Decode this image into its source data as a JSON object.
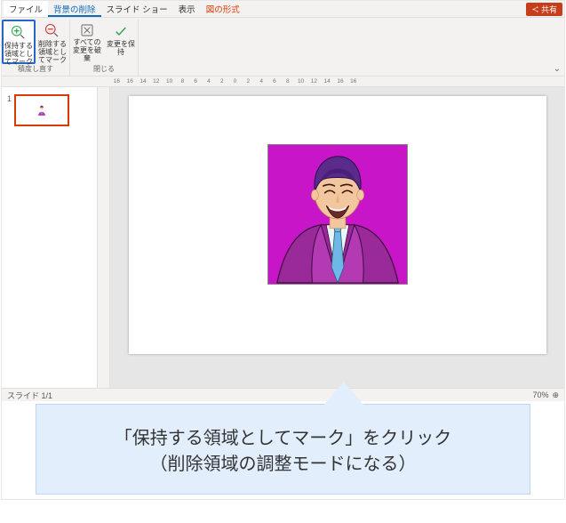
{
  "menubar": {
    "file": "ファイル",
    "active": "背景の削除",
    "slideshow": "スライド ショー",
    "view": "表示",
    "context": "図の形式",
    "share": "共有"
  },
  "ribbon": {
    "group1_label": "積度し直す",
    "group2_label": "閉じる",
    "btn_keep": "保持する領域としてマーク",
    "btn_remove": "削除する領域としてマーク",
    "btn_discard": "すべての変更を破棄",
    "btn_apply": "変更を保持"
  },
  "ruler": [
    "16",
    "16",
    "14",
    "12",
    "10",
    "8",
    "6",
    "4",
    "2",
    "0",
    "2",
    "4",
    "6",
    "8",
    "10",
    "12",
    "14",
    "16",
    "16"
  ],
  "thumb_num": "1",
  "status": {
    "left": "スライド 1/1",
    "zoom": "70%"
  },
  "callout": {
    "line1": "「保持する領域としてマーク」をクリック",
    "line2": "（削除領域の調整モードになる）"
  }
}
